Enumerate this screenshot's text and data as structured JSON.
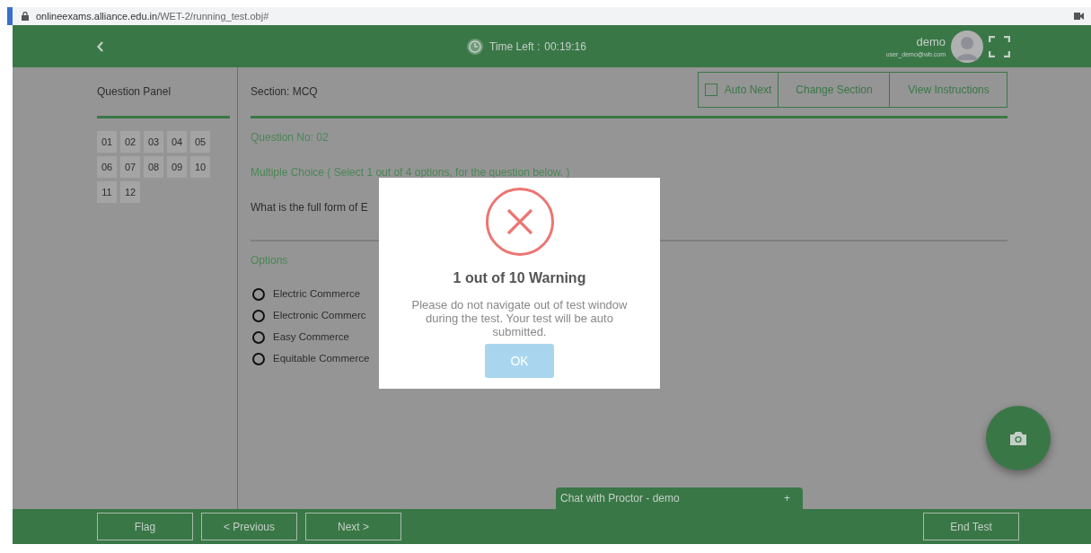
{
  "browser": {
    "url_host": "onlineexams.alliance.edu.in",
    "url_path": "/WET-2/running_test.obj#"
  },
  "header": {
    "timer_label": "Time Left :",
    "timer_value": "00:19:16",
    "user_name": "demo",
    "user_email": "user_demo@wb.com"
  },
  "question_panel": {
    "title": "Question Panel",
    "numbers": [
      {
        "label": "01"
      },
      {
        "label": "02"
      },
      {
        "label": "03"
      },
      {
        "label": "04"
      },
      {
        "label": "05"
      },
      {
        "label": "06"
      },
      {
        "label": "07"
      },
      {
        "label": "08"
      },
      {
        "label": "09"
      },
      {
        "label": "10"
      },
      {
        "label": "11"
      },
      {
        "label": "12"
      }
    ]
  },
  "section": {
    "title": "Section: MCQ",
    "auto_next": {
      "label": "Auto Next",
      "checked": false
    },
    "buttons": [
      "Change Section",
      "View Instructions"
    ]
  },
  "question": {
    "number": "Question No: 02",
    "type": "Multiple Choice ( Select 1 out of 4 options, for the question below. )",
    "text": "What is the full form of E",
    "options_title": "Options",
    "options": [
      {
        "label": "Electric Commerce",
        "selected": false
      },
      {
        "label": "Electronic Commerc",
        "selected": false
      },
      {
        "label": "Easy Commerce",
        "selected": false
      },
      {
        "label": "Equitable Commerce",
        "selected": false
      }
    ]
  },
  "dialog": {
    "title": "1 out of 10 Warning",
    "message": "Please do not navigate out of test window during the test. Your test will be auto submitted.",
    "button": "OK"
  },
  "chat": {
    "label": "Chat with Proctor - demo",
    "toggle": "+"
  },
  "footer": {
    "buttons": [
      "Flag",
      "< Previous",
      "Next >"
    ],
    "end_button": "End Test"
  }
}
